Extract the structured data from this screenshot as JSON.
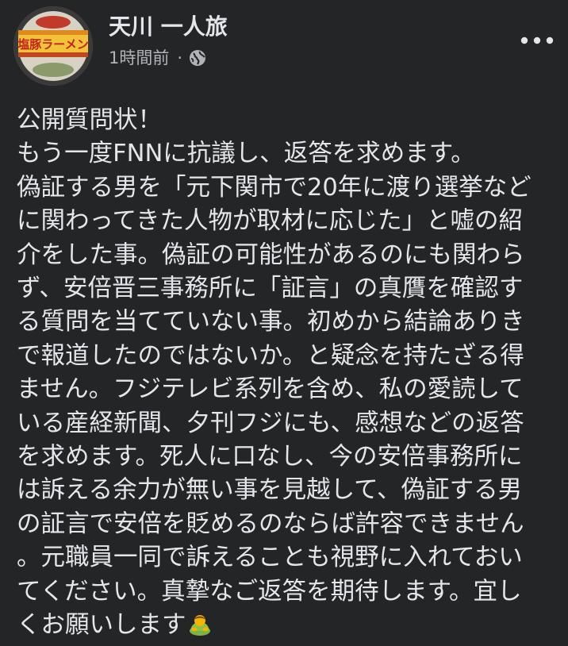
{
  "author": {
    "name": "天川 一人旅",
    "avatar_text": "塩豚ラーメン",
    "avatar_icon": "ramen-cup-avatar"
  },
  "meta": {
    "timestamp": "1時間前",
    "separator": "·",
    "privacy_icon": "globe-icon"
  },
  "menu": {
    "icon": "more-horizontal-icon"
  },
  "post": {
    "lines": [
      "公開質問状！",
      "もう一度FNNに抗議し、返答を求めます。",
      "偽証する男を「元下関市で20年に渡り選挙など",
      "に関わってきた人物が取材に応じた」と嘘の紹",
      "介をした事。偽証の可能性があるのにも関わら",
      "ず、安倍晋三事務所に「証言」の真贋を確認す",
      "る質問を当てていない事。初めから結論ありき",
      "で報道したのではないか。と疑念を持たざる得",
      "ません。フジテレビ系列を含め、私の愛読して",
      "いる産経新聞、夕刊フジにも、感想などの返答",
      "を求めます。死人に口なし、今の安倍事務所に",
      "は訴える余力が無い事を見越して、偽証する男",
      "の証言で安倍を貶めるのならば許容できません",
      "。元職員一同で訴えることも視野に入れておい",
      "てください。真摯なご返答を期待します。宜し",
      "くお願いします"
    ],
    "trailing_emoji": "person-bowing-emoji"
  }
}
